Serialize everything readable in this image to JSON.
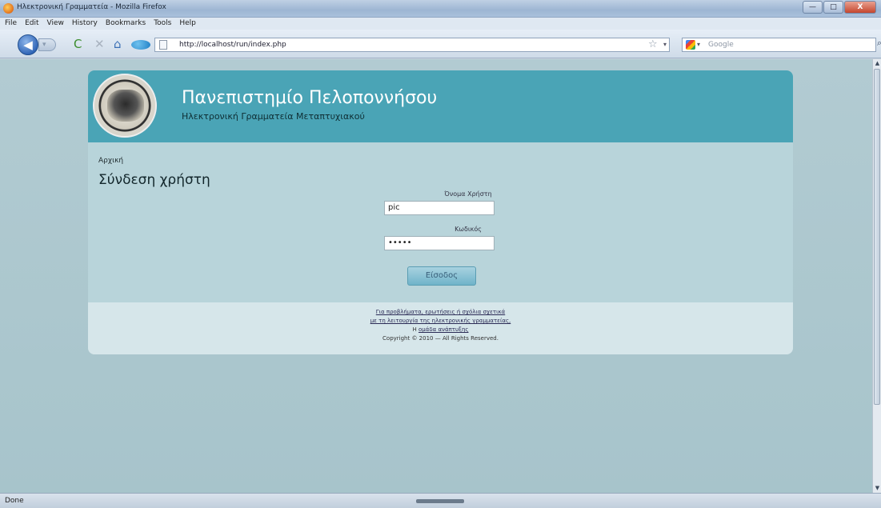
{
  "window": {
    "title": "Ηλεκτρονική Γραμματεία - Mozilla Firefox",
    "min_label": "—",
    "max_label": "□",
    "close_label": "X"
  },
  "menu": {
    "items": [
      "File",
      "Edit",
      "View",
      "History",
      "Bookmarks",
      "Tools",
      "Help"
    ]
  },
  "toolbar": {
    "back_glyph": "◀",
    "forward_glyph": "▾",
    "reload_glyph": "C",
    "stop_glyph": "✕",
    "home_glyph": "⌂",
    "url": "http://localhost/run/index.php",
    "star_glyph": "☆",
    "dropmark_glyph": "▾",
    "search_engine_dropmark": "▾",
    "search_placeholder": "Google",
    "search_glyph": "⌕"
  },
  "page": {
    "site_title": "Πανεπιστημίο Πελοποννήσου",
    "site_subtitle": "Ηλεκτρονική Γραμματεία Μεταπτυχιακού",
    "breadcrumb": "Αρχική",
    "heading": "Σύνδεση χρήστη",
    "username_label": "Όνομα Χρήστη",
    "username_value": "pic",
    "password_label": "Κωδικός",
    "password_value": "•••••",
    "login_button": "Είσοδος",
    "footer_line1": "Για προβλήματα, ερωτήσεις ή σχόλια σχετικά",
    "footer_line2": "με τη λειτουργία της ηλεκτρονικής γραμματείας,",
    "footer_line3_prefix": "Η",
    "footer_line3_link": "ομάδα ανάπτυξης",
    "copyright": "Copyright © 2010 — All Rights Reserved."
  },
  "scrollbar": {
    "up_glyph": "▲",
    "down_glyph": "▼"
  },
  "status": {
    "text": "Done"
  },
  "colors": {
    "header_bg": "#4aa4b6",
    "page_bg": "#a7c4cb",
    "card_bg": "#b8d4da",
    "footer_bg": "#d6e6ea"
  }
}
